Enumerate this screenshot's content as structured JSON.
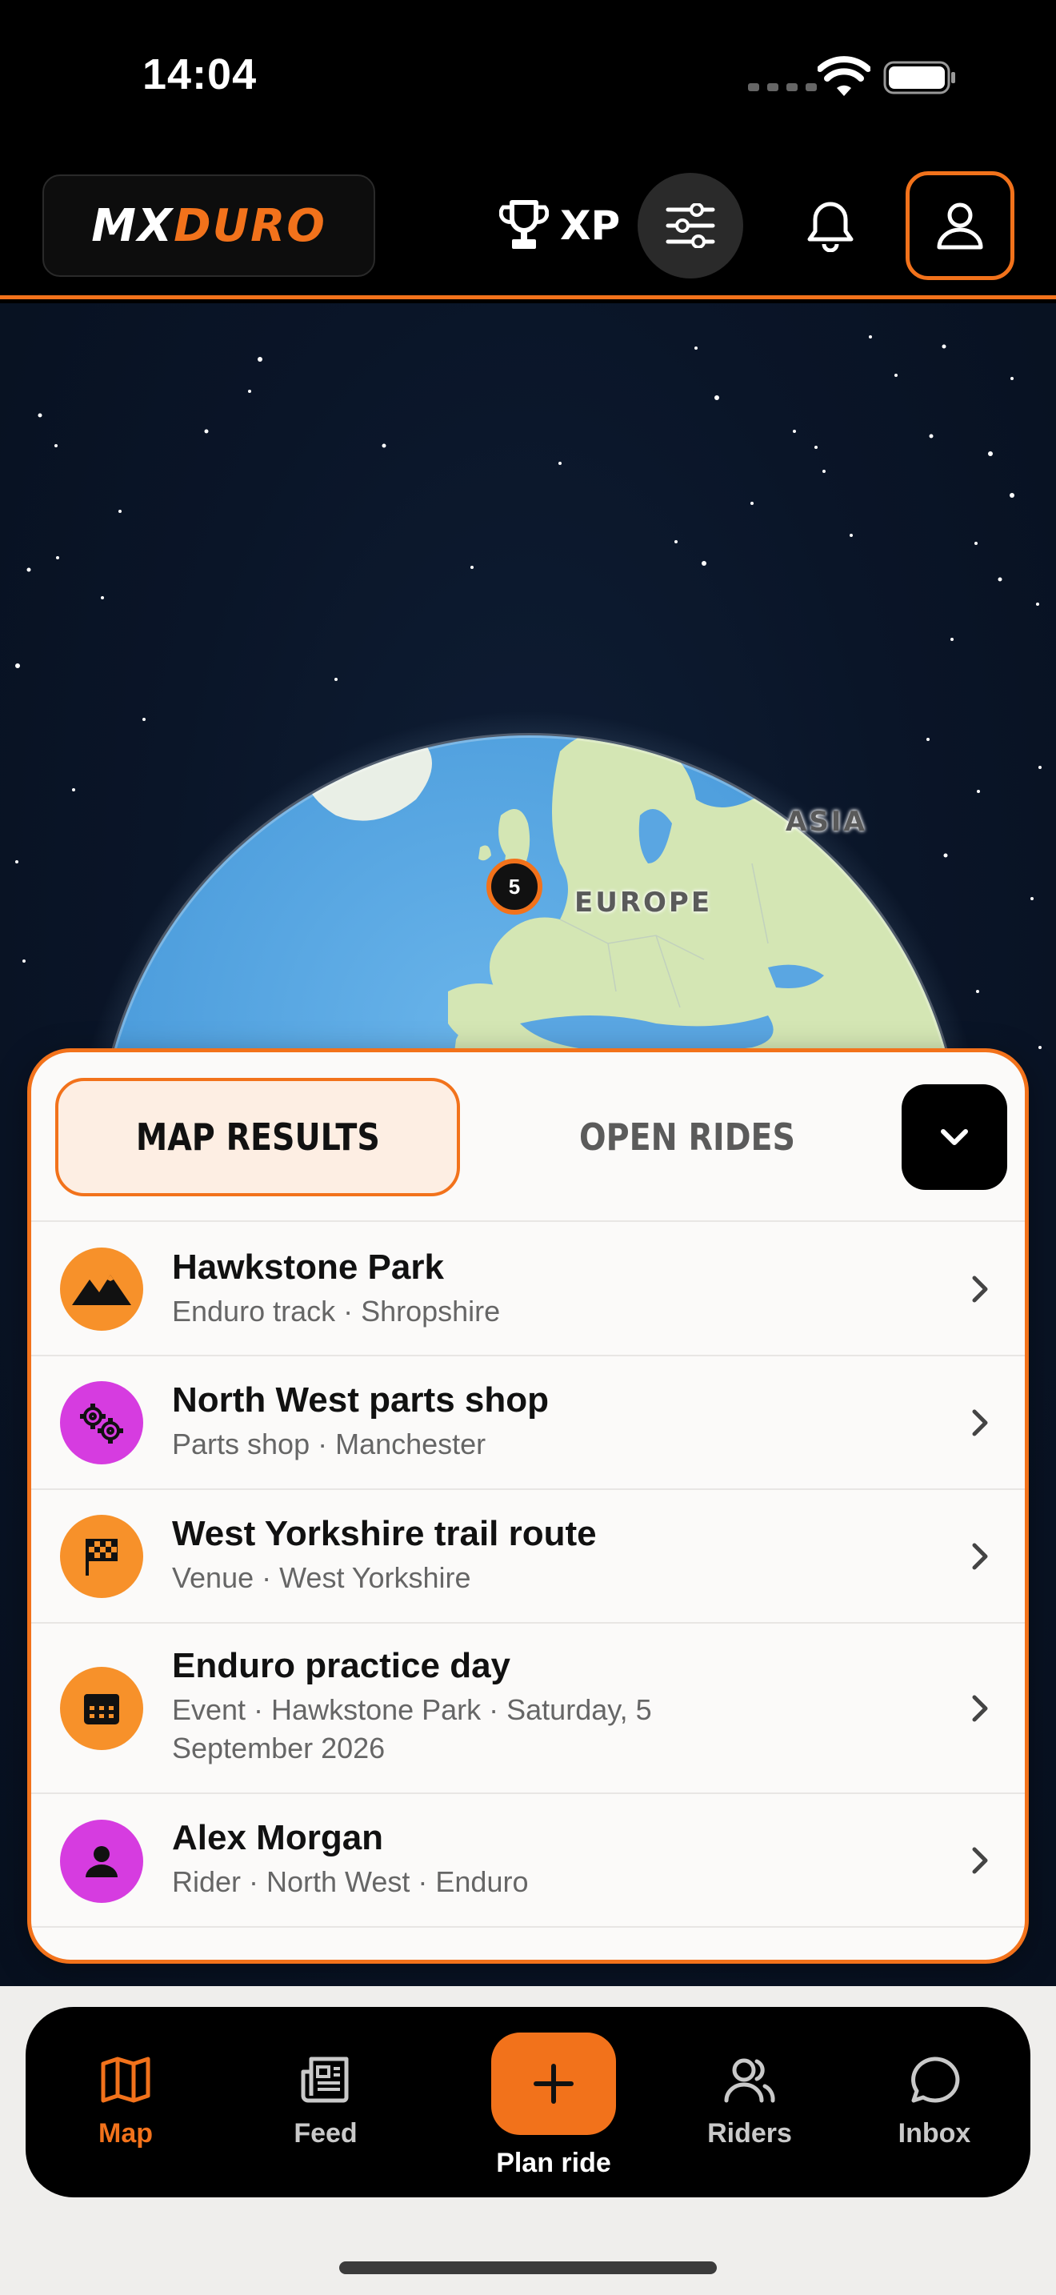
{
  "status_bar": {
    "time": "14:04"
  },
  "header": {
    "logo_part1": "MX",
    "logo_part2": "DURO",
    "xp_label": "XP",
    "icons": [
      "trophy-icon",
      "sliders-icon",
      "bell-icon",
      "user-icon"
    ]
  },
  "map": {
    "labels": {
      "europe": "EUROPE",
      "asia": "ASIA"
    },
    "cluster_count": "5"
  },
  "results_sheet": {
    "tabs": [
      {
        "label": "MAP RESULTS",
        "active": true
      },
      {
        "label": "OPEN RIDES",
        "active": false
      }
    ],
    "items": [
      {
        "title": "Hawkstone Park",
        "subtitle": "Enduro track · Shropshire",
        "icon": "mountains-icon",
        "color": "#f7912a"
      },
      {
        "title": "North West parts shop",
        "subtitle": "Parts shop · Manchester",
        "icon": "gears-icon",
        "color": "#d63ce0"
      },
      {
        "title": "West Yorkshire trail route",
        "subtitle": "Venue · West Yorkshire",
        "icon": "checkered-flag-icon",
        "color": "#f7912a"
      },
      {
        "title": "Enduro practice day",
        "subtitle": "Event · Hawkstone Park · Saturday, 5 September 2026",
        "icon": "calendar-icon",
        "color": "#f7912a"
      },
      {
        "title": "Alex Morgan",
        "subtitle": "Rider · North West · Enduro",
        "icon": "person-icon",
        "color": "#d63ce0"
      }
    ]
  },
  "nav": {
    "items": [
      {
        "label": "Map",
        "icon": "map-icon",
        "active": true
      },
      {
        "label": "Feed",
        "icon": "newspaper-icon",
        "active": false
      },
      {
        "label": "Plan ride",
        "icon": "plus-icon",
        "active": false
      },
      {
        "label": "Riders",
        "icon": "users-icon",
        "active": false
      },
      {
        "label": "Inbox",
        "icon": "chat-bubble-icon",
        "active": false
      }
    ]
  },
  "colors": {
    "accent": "#f2721b",
    "purple": "#d63ce0",
    "orange_icon": "#f7912a"
  }
}
